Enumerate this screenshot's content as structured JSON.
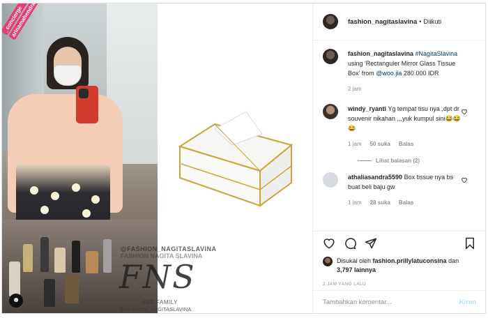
{
  "post": {
    "header": {
      "username": "fashion_nagitaslavina",
      "separator": "•",
      "follow_label": "Diikuti"
    },
    "caption": {
      "username": "fashion_nagitaslavina",
      "hashtag": "#NagitaSlavina",
      "text_before_mention": "using 'Rectanguler Mirror Glass Tissue Box' from",
      "mention": "@woo.jia",
      "text_after_mention": "280.000 IDR",
      "time": "2 jam"
    },
    "comments": [
      {
        "username": "windy_ryanti",
        "text": "Yg tempat tisu nya ,dpt dr souvenir nikahan ,,,yuk kumpul sini😂😂😂",
        "time": "1 jam",
        "likes": "50 suka",
        "reply_label": "Balas",
        "view_replies": "Lihat balasan (2)"
      },
      {
        "username": "athaliasandra5590",
        "text": "Box tissue nya bs buat beli baju gw",
        "time": "1 jam",
        "likes": "28 suka",
        "reply_label": "Balas"
      }
    ],
    "liked_by": {
      "prefix": "Disukai oleh",
      "user": "fashion.prillylatuconsina",
      "joiner": "dan",
      "others": "3,797 lainnya"
    },
    "timestamp": "2 JAM YANG LALU",
    "add_comment": {
      "placeholder": "Tambahkan komentar...",
      "post_label": "Kirim"
    }
  },
  "image_overlay": {
    "tag_lines": [
      "_concierge",
      "arinamahendra"
    ],
    "watermark_top": "@FASHION_NAGITASLAVINA",
    "watermark_top2": "FASHION NAGITA SLAVINA",
    "watermark_logo": "FNS",
    "watermark_sub": "AND FAMILY",
    "watermark_bottom": "@FASHION_NAGITASLAVINA"
  },
  "icons": {
    "like": "heart-icon",
    "comment": "comment-icon",
    "share": "paper-plane-icon",
    "save": "bookmark-icon",
    "user_tag": "user-tag-icon"
  },
  "colors": {
    "link": "#00376b",
    "muted": "#8e8e8e",
    "post_button": "#b2dffc",
    "tag_background": "#e33d74"
  }
}
